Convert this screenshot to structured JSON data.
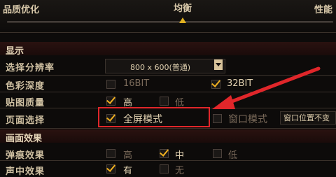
{
  "quality_bar": {
    "left_label": "品质优化",
    "center_label": "均衡",
    "right_label": "性能"
  },
  "display": {
    "section_title": "显示",
    "rows": {
      "resolution": {
        "label": "选择分辨率",
        "value": "800 x 600(普通)"
      },
      "color_depth": {
        "label": "色彩深度",
        "opt1": "16BIT",
        "opt2": "32BIT"
      },
      "texture_quality": {
        "label": "贴图质量",
        "opt1": "高",
        "opt2": "低"
      },
      "screen_mode": {
        "label": "页面选择",
        "opt1": "全屏模式",
        "opt2": "窗口模式",
        "opt3": "窗口位置不变"
      }
    }
  },
  "effects": {
    "section_title": "画面效果",
    "rows": {
      "particle": {
        "label": "弹痕效果",
        "opt1": "高",
        "opt2": "中",
        "opt3": "低"
      },
      "partial": {
        "label": "声中效果",
        "opt1": "有",
        "opt2": "无"
      }
    }
  },
  "colors": {
    "accent": "#f0b020",
    "highlight": "#e0262a"
  }
}
